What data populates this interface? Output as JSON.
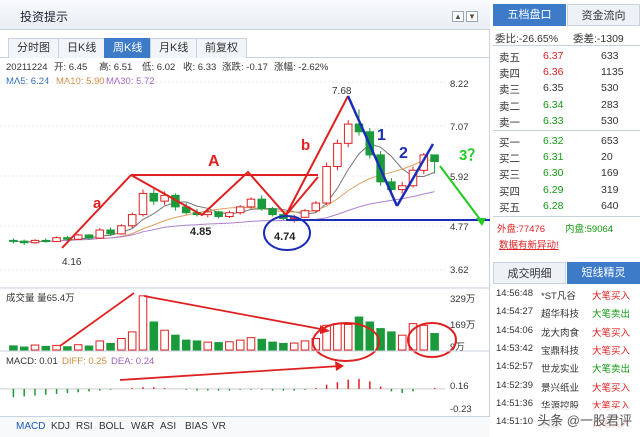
{
  "window": {
    "title": "投资提示",
    "controls": [
      "▲",
      "▼",
      "×"
    ]
  },
  "chart_tabs": [
    {
      "label": "分时图",
      "active": false
    },
    {
      "label": "日K线",
      "active": false
    },
    {
      "label": "周K线",
      "active": true
    },
    {
      "label": "月K线",
      "active": false
    },
    {
      "label": "前复权",
      "active": false
    }
  ],
  "info_line": {
    "date": "20211224",
    "open": "开: 6.45",
    "high": "高: 6.51",
    "low": "低: 6.02",
    "close": "收: 6.33",
    "change": "涨跌: -0.17",
    "pct": "涨幅: -2.62%"
  },
  "ma_line": {
    "ma5": "MA5: 6.24",
    "ma10": "MA10: 5.90",
    "ma30": "MA30: 5.72"
  },
  "volume_line": "成交量 量65.4万",
  "macd_line": {
    "macd": "MACD: 0.01",
    "diff": "DIFF: 0.25",
    "dea": "DEA: 0.24"
  },
  "price_axis": [
    "8.22",
    "7.07",
    "5.92",
    "4.77",
    "3.62"
  ],
  "volume_axis": [
    "329万",
    "169万",
    "9万"
  ],
  "macd_axis": [
    "0.16",
    "-0.23"
  ],
  "annotations": {
    "a": "a",
    "A": "A",
    "b": "b",
    "one": "1",
    "two": "2",
    "three": "3？",
    "p416": "4.16",
    "p485": "4.85",
    "p474": "4.74",
    "p768": "7.68"
  },
  "colors": {
    "up": "#e02020",
    "down": "#1a9a3a",
    "ma5": "#777777",
    "ma10": "#e0a060",
    "ma30": "#b080d0",
    "accent": "#3d7bc8",
    "blue_line": "#1a2db8",
    "green_arrow": "#22cc22"
  },
  "chart_data": {
    "type": "candlestick",
    "price_range": [
      3.2,
      8.6
    ],
    "candles": [
      [
        4.28,
        4.33,
        4.2,
        4.26
      ],
      [
        4.26,
        4.3,
        4.16,
        4.22
      ],
      [
        4.22,
        4.31,
        4.19,
        4.28
      ],
      [
        4.28,
        4.33,
        4.22,
        4.25
      ],
      [
        4.25,
        4.38,
        4.24,
        4.35
      ],
      [
        4.35,
        4.4,
        4.28,
        4.31
      ],
      [
        4.31,
        4.45,
        4.29,
        4.42
      ],
      [
        4.42,
        4.44,
        4.3,
        4.34
      ],
      [
        4.34,
        4.6,
        4.32,
        4.55
      ],
      [
        4.55,
        4.62,
        4.4,
        4.45
      ],
      [
        4.45,
        4.7,
        4.43,
        4.66
      ],
      [
        4.66,
        5.0,
        4.6,
        4.95
      ],
      [
        4.95,
        5.6,
        4.9,
        5.5
      ],
      [
        5.5,
        5.62,
        5.2,
        5.3
      ],
      [
        5.3,
        5.55,
        5.2,
        5.45
      ],
      [
        5.45,
        5.5,
        5.05,
        5.15
      ],
      [
        5.15,
        5.25,
        4.95,
        5.0
      ],
      [
        5.0,
        5.1,
        4.9,
        4.95
      ],
      [
        4.95,
        5.08,
        4.88,
        5.02
      ],
      [
        5.02,
        5.05,
        4.85,
        4.9
      ],
      [
        4.9,
        5.05,
        4.86,
        5.0
      ],
      [
        5.0,
        5.2,
        4.95,
        5.15
      ],
      [
        5.15,
        5.4,
        5.1,
        5.35
      ],
      [
        5.35,
        5.45,
        5.05,
        5.1
      ],
      [
        5.1,
        5.15,
        4.9,
        4.95
      ],
      [
        4.95,
        5.0,
        4.8,
        4.85
      ],
      [
        4.85,
        4.95,
        4.74,
        4.88
      ],
      [
        4.88,
        5.1,
        4.86,
        5.05
      ],
      [
        5.05,
        5.3,
        5.0,
        5.25
      ],
      [
        5.25,
        6.3,
        5.2,
        6.2
      ],
      [
        6.2,
        6.9,
        6.1,
        6.8
      ],
      [
        6.8,
        7.4,
        6.7,
        7.3
      ],
      [
        7.3,
        7.68,
        7.0,
        7.1
      ],
      [
        7.1,
        7.2,
        6.4,
        6.5
      ],
      [
        6.5,
        6.6,
        5.7,
        5.8
      ],
      [
        5.8,
        5.9,
        5.45,
        5.6
      ],
      [
        5.6,
        5.8,
        5.5,
        5.7
      ],
      [
        5.7,
        6.2,
        5.65,
        6.1
      ],
      [
        6.1,
        6.55,
        6.0,
        6.5
      ],
      [
        6.5,
        6.51,
        6.02,
        6.33
      ]
    ],
    "volume_range": [
      0,
      340
    ],
    "volume": [
      25,
      18,
      30,
      22,
      28,
      20,
      32,
      24,
      55,
      40,
      70,
      110,
      329,
      170,
      120,
      90,
      60,
      55,
      48,
      45,
      50,
      60,
      75,
      65,
      48,
      40,
      42,
      55,
      70,
      150,
      160,
      155,
      200,
      170,
      130,
      110,
      90,
      160,
      150,
      100
    ],
    "macd_range": [
      -0.3,
      0.25
    ],
    "macd_hist": [
      -0.1,
      -0.09,
      -0.08,
      -0.07,
      -0.06,
      -0.05,
      -0.04,
      -0.03,
      -0.02,
      -0.01,
      0.0,
      0.01,
      0.02,
      0.02,
      0.01,
      0.0,
      -0.01,
      -0.02,
      -0.02,
      -0.02,
      -0.02,
      -0.01,
      -0.01,
      -0.01,
      -0.02,
      -0.02,
      -0.02,
      -0.01,
      0.01,
      0.05,
      0.08,
      0.11,
      0.12,
      0.09,
      0.03,
      -0.03,
      -0.05,
      -0.03,
      0.0,
      0.01
    ]
  },
  "order_book": {
    "tabs": [
      {
        "label": "五档盘口",
        "active": true
      },
      {
        "label": "资金流向",
        "active": false
      }
    ],
    "weibi": "委比:-26.65%",
    "weicha": "委差:-1309",
    "sells": [
      {
        "label": "卖五",
        "price": "6.37",
        "vol": "633",
        "color": "red"
      },
      {
        "label": "卖四",
        "price": "6.36",
        "vol": "1135",
        "color": "red"
      },
      {
        "label": "卖三",
        "price": "6.35",
        "vol": "530",
        "color": "gray"
      },
      {
        "label": "卖二",
        "price": "6.34",
        "vol": "283",
        "color": "green"
      },
      {
        "label": "卖一",
        "price": "6.33",
        "vol": "530",
        "color": "green"
      }
    ],
    "buys": [
      {
        "label": "买一",
        "price": "6.32",
        "vol": "653",
        "color": "green"
      },
      {
        "label": "买二",
        "price": "6.31",
        "vol": "20",
        "color": "green"
      },
      {
        "label": "买三",
        "price": "6.30",
        "vol": "169",
        "color": "green"
      },
      {
        "label": "买四",
        "price": "6.29",
        "vol": "319",
        "color": "green"
      },
      {
        "label": "买五",
        "price": "6.28",
        "vol": "640",
        "color": "green"
      }
    ],
    "outer": "外盘:77476",
    "inner": "内盘:59064",
    "notice": "数据有新异动!"
  },
  "trades_panel": {
    "tabs": [
      {
        "label": "成交明细",
        "active": false
      },
      {
        "label": "短线精灵",
        "active": true
      }
    ],
    "rows": [
      {
        "time": "14:56:48",
        "name": "*ST凡谷",
        "action": "大笔买入"
      },
      {
        "time": "14:54:27",
        "name": "超华科技",
        "action": "大笔卖出"
      },
      {
        "time": "14:54:06",
        "name": "龙大肉食",
        "action": "大笔买入"
      },
      {
        "time": "14:53:42",
        "name": "宝鼎科技",
        "action": "大笔买入"
      },
      {
        "time": "14:52:57",
        "name": "世龙实业",
        "action": "大笔卖出"
      },
      {
        "time": "14:52:39",
        "name": "景兴纸业",
        "action": "大笔买入"
      },
      {
        "time": "14:51:36",
        "name": "华源控股",
        "action": "大笔买入"
      },
      {
        "time": "14:51:10",
        "name": "利源",
        "action": "大笔买入"
      }
    ]
  },
  "indicator_tabs": [
    {
      "label": "MACD",
      "active": true
    },
    {
      "label": "KDJ",
      "active": false
    },
    {
      "label": "RSI",
      "active": false
    },
    {
      "label": "BOLL",
      "active": false
    },
    {
      "label": "W&R",
      "active": false
    },
    {
      "label": "ASI",
      "active": false
    },
    {
      "label": "BIAS",
      "active": false
    },
    {
      "label": "VR",
      "active": false
    }
  ],
  "watermark": "头条 @一股君评"
}
